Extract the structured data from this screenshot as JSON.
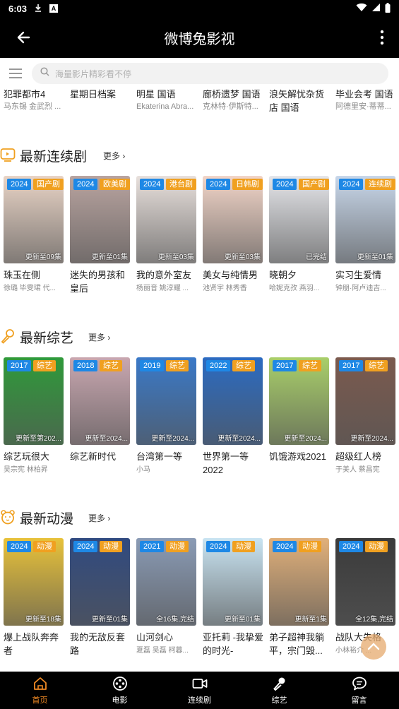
{
  "status": {
    "time": "6:03",
    "a_icon": "A"
  },
  "appbar": {
    "title": "微博兔影视"
  },
  "search": {
    "placeholder": "海量影片精彩看不停"
  },
  "top_row": [
    {
      "title": "犯罪都市4",
      "sub": "马东锡 金武烈 ..."
    },
    {
      "title": "星期日档案",
      "sub": ""
    },
    {
      "title": "明星 国语",
      "sub": "Ekaterina Abra..."
    },
    {
      "title": "廊桥遗梦 国语",
      "sub": "克林特·伊斯特..."
    },
    {
      "title": "浪矢解忧杂货",
      "title2": "店 国语",
      "sub": ""
    },
    {
      "title": "毕业会考 国语",
      "sub": "阿德里安·蒂蒂..."
    }
  ],
  "sections": [
    {
      "title": "最新连续剧",
      "more": "更多",
      "items": [
        {
          "year": "2024",
          "genre": "国产剧",
          "status": "更新至09集",
          "title": "珠玉在侧",
          "sub": "徐璐 毕雯珺 代..."
        },
        {
          "year": "2024",
          "genre": "欧美剧",
          "status": "更新至01集",
          "title": "迷失的男孩和皇后",
          "sub": ""
        },
        {
          "year": "2024",
          "genre": "港台剧",
          "status": "更新至03集",
          "title": "我的意外室友",
          "sub": "杨丽音 姚淳耀 ..."
        },
        {
          "year": "2024",
          "genre": "日韩剧",
          "status": "更新至03集",
          "title": "美女与纯情男",
          "sub": "池贤宇 林秀香"
        },
        {
          "year": "2024",
          "genre": "国产剧",
          "status": "已完结",
          "title": "晓朝夕",
          "sub": "哈妮克孜 燕羽..."
        },
        {
          "year": "2024",
          "genre": "连续剧",
          "status": "更新至01集",
          "title": "实习生爱情",
          "sub": "钟朋·阿卢迪吉..."
        }
      ]
    },
    {
      "title": "最新综艺",
      "more": "更多",
      "items": [
        {
          "year": "2017",
          "genre": "综艺",
          "status": "更新至第202...",
          "title": "综艺玩很大",
          "sub": "吴宗宪 林柏昇"
        },
        {
          "year": "2018",
          "genre": "综艺",
          "status": "更新至2024...",
          "title": "综艺新时代",
          "sub": ""
        },
        {
          "year": "2019",
          "genre": "综艺",
          "status": "更新至2024...",
          "title": "台湾第一等",
          "sub": "小马"
        },
        {
          "year": "2022",
          "genre": "综艺",
          "status": "更新至2024...",
          "title": "世界第一等2022",
          "sub": ""
        },
        {
          "year": "2017",
          "genre": "综艺",
          "status": "更新至2024...",
          "title": "饥饿游戏2021",
          "sub": ""
        },
        {
          "year": "2017",
          "genre": "综艺",
          "status": "更新至2024...",
          "title": "超级红人榜",
          "sub": "于美人 蔡昌宪"
        }
      ]
    },
    {
      "title": "最新动漫",
      "more": "更多",
      "items": [
        {
          "year": "2024",
          "genre": "动漫",
          "status": "更新至18集",
          "title": "爆上战队奔奔者",
          "sub": ""
        },
        {
          "year": "2024",
          "genre": "动漫",
          "status": "更新至01集",
          "title": "我的无敌反套路",
          "sub": ""
        },
        {
          "year": "2021",
          "genre": "动漫",
          "status": "全16集,完结",
          "title": "山河剑心",
          "sub": "夏磊 吴磊 柯暮..."
        },
        {
          "year": "2024",
          "genre": "动漫",
          "status": "更新至01集",
          "title": "亚托莉 -我挚爱的时光-",
          "sub": ""
        },
        {
          "year": "2024",
          "genre": "动漫",
          "status": "更新至1集",
          "title": "弟子超神我躺平，宗门毁...",
          "sub": ""
        },
        {
          "year": "2024",
          "genre": "动漫",
          "status": "全12集,完结",
          "title": "战队大失格",
          "sub": "小林裕介 ..."
        }
      ]
    }
  ],
  "nav": [
    {
      "label": "首页",
      "icon": "home-icon",
      "active": true
    },
    {
      "label": "电影",
      "icon": "film-reel-icon"
    },
    {
      "label": "连续剧",
      "icon": "video-camera-icon"
    },
    {
      "label": "综艺",
      "icon": "microphone-icon"
    },
    {
      "label": "留言",
      "icon": "chat-bubble-icon"
    }
  ],
  "colors": {
    "accent": "#f08a24",
    "year_badge": "#1e88e5",
    "genre_badge": "#f0a020"
  }
}
